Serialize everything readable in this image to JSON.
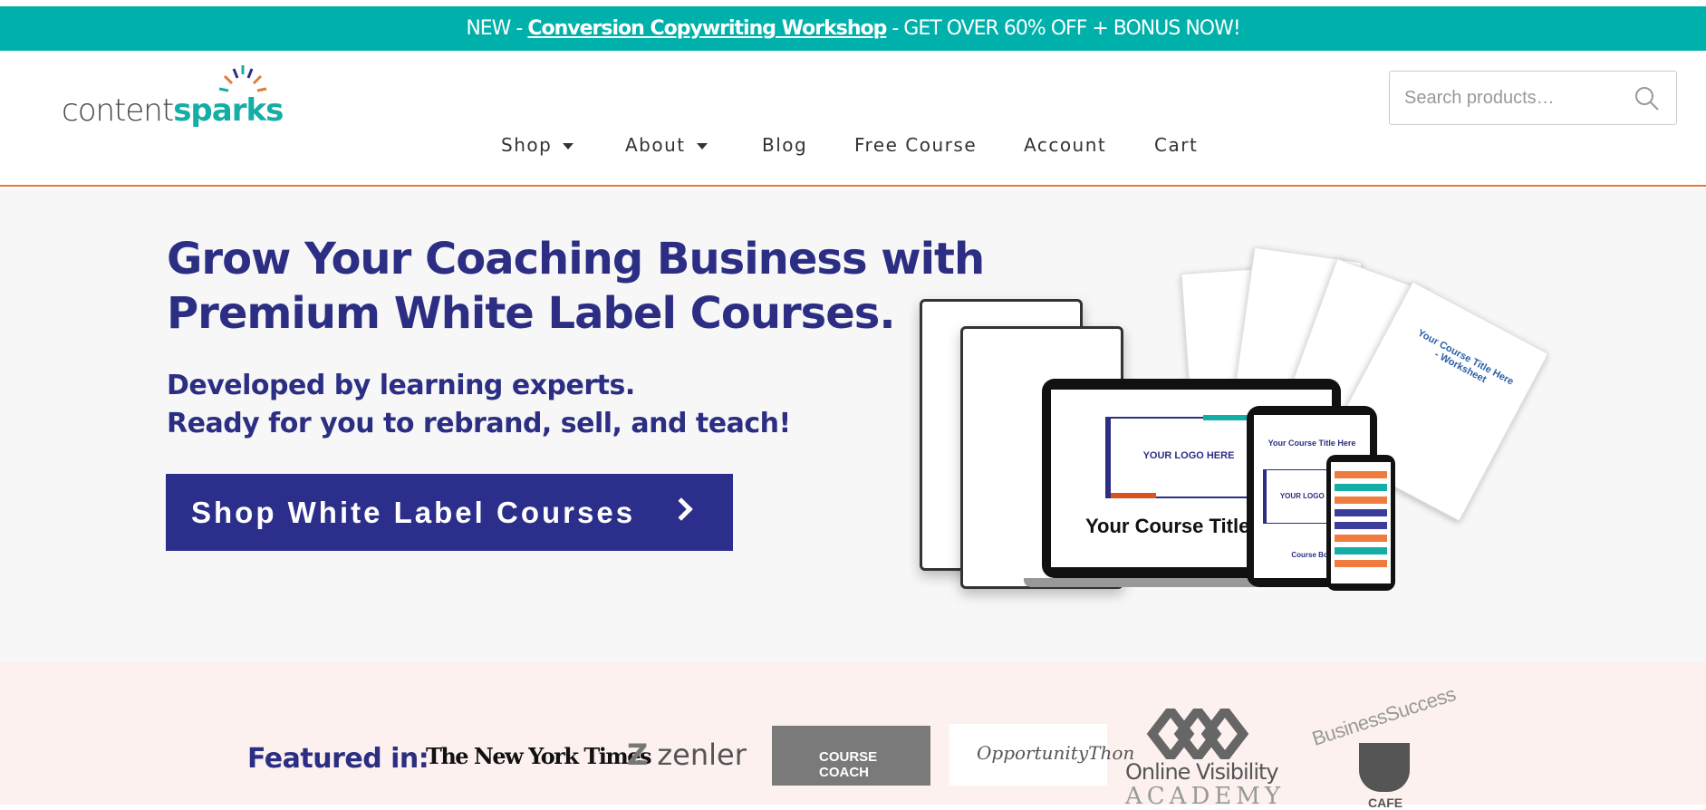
{
  "banner": {
    "prefix": "NEW - ",
    "link": "Conversion Copywriting Workshop",
    "suffix": " - GET OVER 60% OFF + BONUS NOW!",
    "bg": "#00b0aa"
  },
  "logo": {
    "part1": "content",
    "part2": "sparks"
  },
  "search": {
    "placeholder": "Search products…",
    "icon": "search-icon"
  },
  "nav": {
    "items": [
      {
        "label": "Shop",
        "dropdown": true
      },
      {
        "label": "About",
        "dropdown": true
      },
      {
        "label": "Blog"
      },
      {
        "label": "Free Course"
      },
      {
        "label": "Account"
      },
      {
        "label": "Cart"
      }
    ]
  },
  "hero": {
    "title_line1": "Grow Your Coaching Business with",
    "title_line2": "Premium White Label Courses.",
    "sub_line1": "Developed by learning experts.",
    "sub_line2": "Ready for you to rebrand, sell, and teach!",
    "cta": "Shop White Label Courses",
    "mockup": {
      "logo_text": "YOUR LOGO HERE",
      "course_title": "Your Course Title H",
      "tablet_title": "Your Course Title Here",
      "tablet_footer": "Course Boo",
      "worksheet": "Your Course Title Here - Worksheet"
    }
  },
  "featured": {
    "label": "Featured in:",
    "logos": [
      "The New York Times",
      "zenler",
      "COURSE COACH",
      "OpportunityThon",
      "Online Visibility",
      "ACADEMY",
      "BusinessSuccess",
      "CAFE"
    ]
  },
  "colors": {
    "brand_navy": "#2b2e83",
    "teal": "#00b0aa",
    "orange": "#e07b39"
  }
}
